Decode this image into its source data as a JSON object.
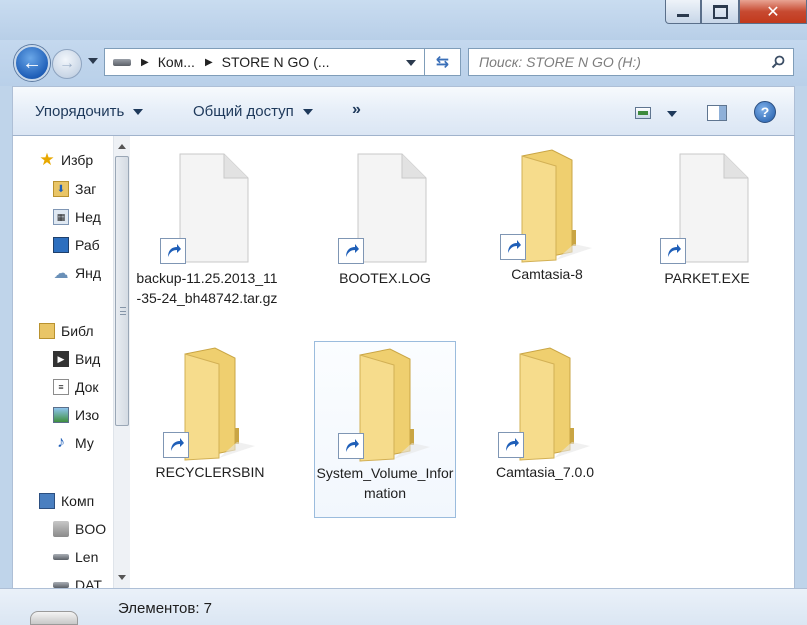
{
  "window": {
    "controls": {
      "minimize": "",
      "maximize": "",
      "close": "✕"
    }
  },
  "address": {
    "crumbs": [
      "Ком...",
      "STORE N GO (..."
    ],
    "search_placeholder": "Поиск: STORE N GO (H:)"
  },
  "toolbar": {
    "organize_label": "Упорядочить",
    "share_label": "Общий доступ",
    "more_label": "»",
    "help_label": "?"
  },
  "nav": {
    "items": [
      {
        "label": "Избранное",
        "icon": "star-icon"
      },
      {
        "label": "Загрузки",
        "icon": "downloads-folder-icon"
      },
      {
        "label": "Недавние места",
        "icon": "recent-places-icon"
      },
      {
        "label": "Рабочий стол",
        "icon": "desktop-icon"
      },
      {
        "label": "Яндекс.Диск",
        "icon": "yandex-disk-icon"
      },
      {
        "label": "Библиотеки",
        "icon": "libraries-icon"
      },
      {
        "label": "Видео",
        "icon": "video-icon"
      },
      {
        "label": "Документы",
        "icon": "documents-icon"
      },
      {
        "label": "Изображения",
        "icon": "pictures-icon"
      },
      {
        "label": "Музыка",
        "icon": "music-icon"
      },
      {
        "label": "Компьютер",
        "icon": "computer-icon"
      },
      {
        "label": "BOOTCAMP",
        "icon": "windows-drive-icon"
      },
      {
        "label": "Lenovo",
        "icon": "drive-icon"
      },
      {
        "label": "DATA",
        "icon": "drive-icon"
      }
    ],
    "visible_text": [
      "Избр",
      "Заг",
      "Нед",
      "Раб",
      "Янд",
      "Библ",
      "Вид",
      "Док",
      "Изо",
      "Му",
      "Комп",
      "BOO",
      "Len",
      "DAT"
    ]
  },
  "files": [
    {
      "name": "backup-11.25.2013_11-35-24_bh48742.tar.gz",
      "kind": "file",
      "shortcut": true
    },
    {
      "name": "BOOTEX.LOG",
      "kind": "file",
      "shortcut": true
    },
    {
      "name": "Camtasia-8",
      "kind": "folder",
      "shortcut": true
    },
    {
      "name": "PARKET.EXE",
      "kind": "file",
      "shortcut": true
    },
    {
      "name": "RECYCLERSBIN",
      "kind": "folder",
      "shortcut": true
    },
    {
      "name": "System_Volume_Information",
      "kind": "folder",
      "shortcut": true,
      "selected": true
    },
    {
      "name": "Camtasia_7.0.0",
      "kind": "folder",
      "shortcut": true
    }
  ],
  "status": {
    "text": "Элементов: 7"
  },
  "colors": {
    "accent": "#1f5fb8",
    "folder": "#f3d77e",
    "selection": "#9bbcdd"
  }
}
